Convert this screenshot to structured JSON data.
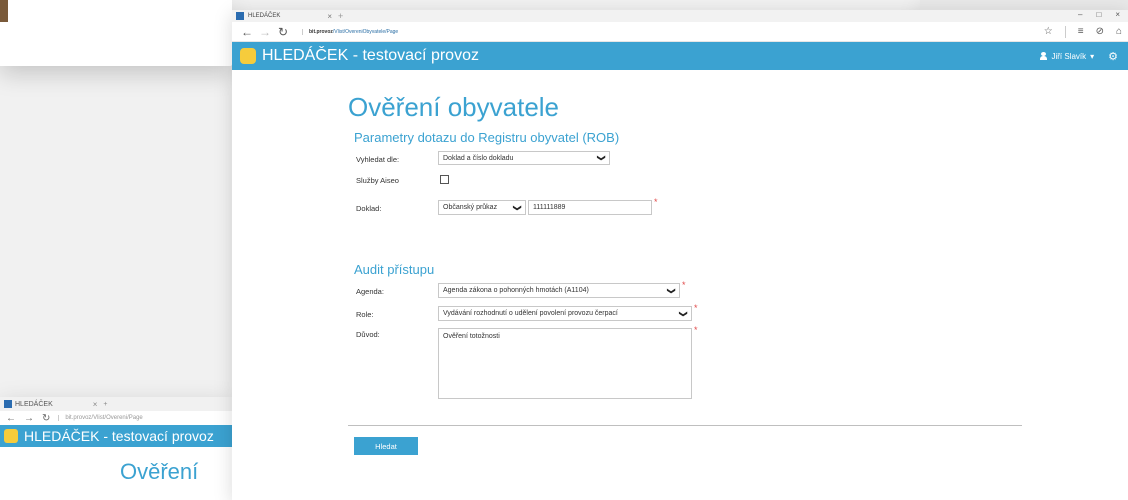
{
  "background_windows": {
    "bottom_left": {
      "tab_title": "HLEDÁČEK",
      "url": "bit.provoz/Vlist/Overeni/Page",
      "app_title": "HLEDÁČEK - testovací provoz",
      "heading": "Ověření"
    }
  },
  "browser": {
    "tab_title": "HLEDÁČEK",
    "tab_close": "×",
    "new_tab": "+",
    "window_controls": [
      "–",
      "□",
      "×"
    ],
    "back": "←",
    "forward": "→",
    "refresh": "↻",
    "url_host": "bit.provoz",
    "url_path": "/Vlist/OvereniObyvatele/Page",
    "toolbar_icons": [
      "☆",
      "≡",
      "⊘",
      "⌂"
    ]
  },
  "app": {
    "title": "HLEDÁČEK - testovací provoz",
    "user_name": "Jiří Slavík",
    "user_chevron": "▾",
    "settings_icon": "⚙"
  },
  "page": {
    "title": "Ověření obyvatele",
    "section1_title": "Parametry dotazu do Registru obyvatel (ROB)",
    "search_by_label": "Vyhledat dle:",
    "search_by_value": "Doklad a číslo dokladu",
    "aiseo_label": "Služby Aiseo",
    "doc_label": "Doklad:",
    "doc_type_value": "Občanský průkaz",
    "doc_number_value": "111111889",
    "section2_title": "Audit přístupu",
    "agenda_label": "Agenda:",
    "agenda_value": "Agenda zákona o pohonných hmotách (A1104)",
    "role_label": "Role:",
    "role_value": "Vydávání rozhodnutí o udělení povolení provozu čerpací",
    "reason_label": "Důvod:",
    "reason_value": "Ověření totožnosti",
    "required_mark": "*",
    "chevron": "❯",
    "search_button": "Hledat"
  },
  "colors": {
    "accent": "#3ba2d1",
    "logo": "#f6cc3c",
    "required": "#e04a4a"
  }
}
